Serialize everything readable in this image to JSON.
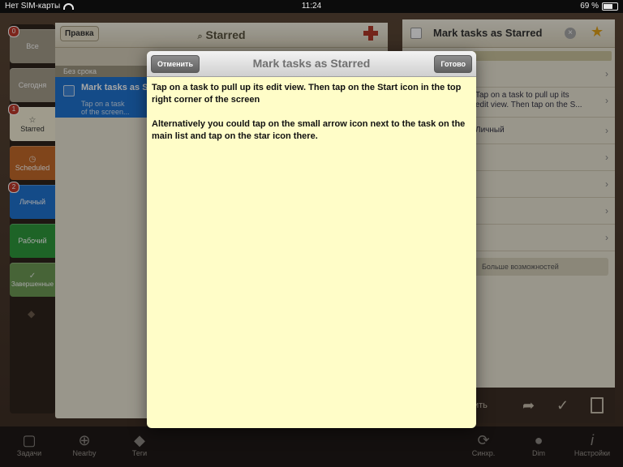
{
  "status_bar": {
    "carrier": "Нет SIM-карты",
    "time": "11:24",
    "battery": "69 %"
  },
  "side_tabs": [
    {
      "label": "Все",
      "badge": "0",
      "color": "#a79f8c"
    },
    {
      "label": "Сегодня",
      "badge": "",
      "color": "#a79f8c"
    },
    {
      "label": "Starred",
      "badge": "1",
      "color": "#f4efd7"
    },
    {
      "label": "Scheduled",
      "badge": "",
      "color": "#c56a2a"
    },
    {
      "label": "Личный",
      "badge": "2",
      "color": "#1f73d1"
    },
    {
      "label": "Рабочий",
      "badge": "",
      "color": "#2e9a3c"
    },
    {
      "label": "Завершенные",
      "badge": "",
      "color": "#6e9a55"
    }
  ],
  "list": {
    "edit_label": "Правка",
    "title": "Starred",
    "section": "Без срока",
    "task_title": "Mark tasks as S",
    "task_note": "Tap on a task",
    "task_note2": "of the screen..."
  },
  "detail": {
    "title": "Mark tasks as Starred",
    "note": "Tap on a task to pull up its edit view. Then tap on the S...",
    "note_line1": "Tap on a task to pull up its",
    "note_line2": "edit view. Then tap on the S...",
    "list_name": "Личный",
    "more": "Больше возможностей",
    "bottom_label": "ить"
  },
  "tab_bar": [
    {
      "label": "Задачи",
      "icon": "square-icon"
    },
    {
      "label": "Nearby",
      "icon": "crosshair-icon"
    },
    {
      "label": "Теги",
      "icon": "tag-icon"
    },
    {
      "label": "Синхр.",
      "icon": "sync-icon"
    },
    {
      "label": "Dim",
      "icon": "bulb-icon"
    },
    {
      "label": "Настройки",
      "icon": "info-icon"
    }
  ],
  "modal": {
    "cancel": "Отменить",
    "title": "Mark tasks as Starred",
    "done": "Готово",
    "para1": "Tap on a task to pull up its edit view. Then tap on the Start icon in the top right corner of the screen",
    "para2": "Alternatively you could tap on the small arrow icon next to the task on the main list and tap on the star icon there."
  }
}
